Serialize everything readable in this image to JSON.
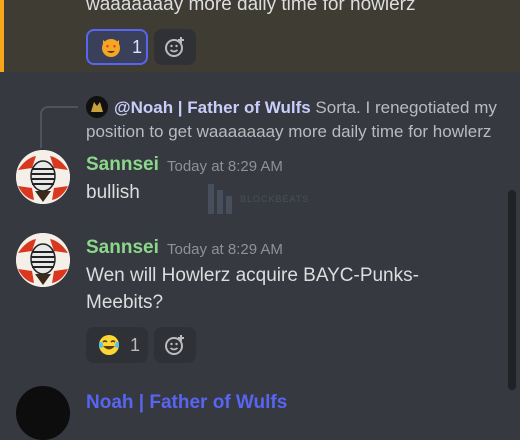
{
  "top_message": {
    "text": "waaaaaaay more daily time for howlerz",
    "reactions": [
      {
        "emoji": "heart-eyes-cat-emoji",
        "count": "1",
        "active": true
      }
    ]
  },
  "reply_message": {
    "reply_to": {
      "mention": "@Noah | Father of Wulfs",
      "snippet": "Sorta. I renegotiated my position to get waaaaaaay more daily time for howlerz"
    },
    "author": "Sannsei",
    "timestamp": "Today at 8:29 AM",
    "text": "bullish"
  },
  "second_message": {
    "author": "Sannsei",
    "timestamp": "Today at 8:29 AM",
    "text": "Wen will Howlerz acquire BAYC-Punks-Meebits?",
    "reactions": [
      {
        "emoji": "joy-emoji",
        "count": "1",
        "active": false
      }
    ]
  },
  "watermark": {
    "text": "BLOCKBEATS"
  },
  "bottom_message": {
    "author": "Noah | Father of Wulfs"
  },
  "colors": {
    "background": "#36393f",
    "highlight_bar": "#faa61a",
    "username": "#8bd78b",
    "mention": "#c9cdfb",
    "reaction_active_border": "#5865f2"
  }
}
